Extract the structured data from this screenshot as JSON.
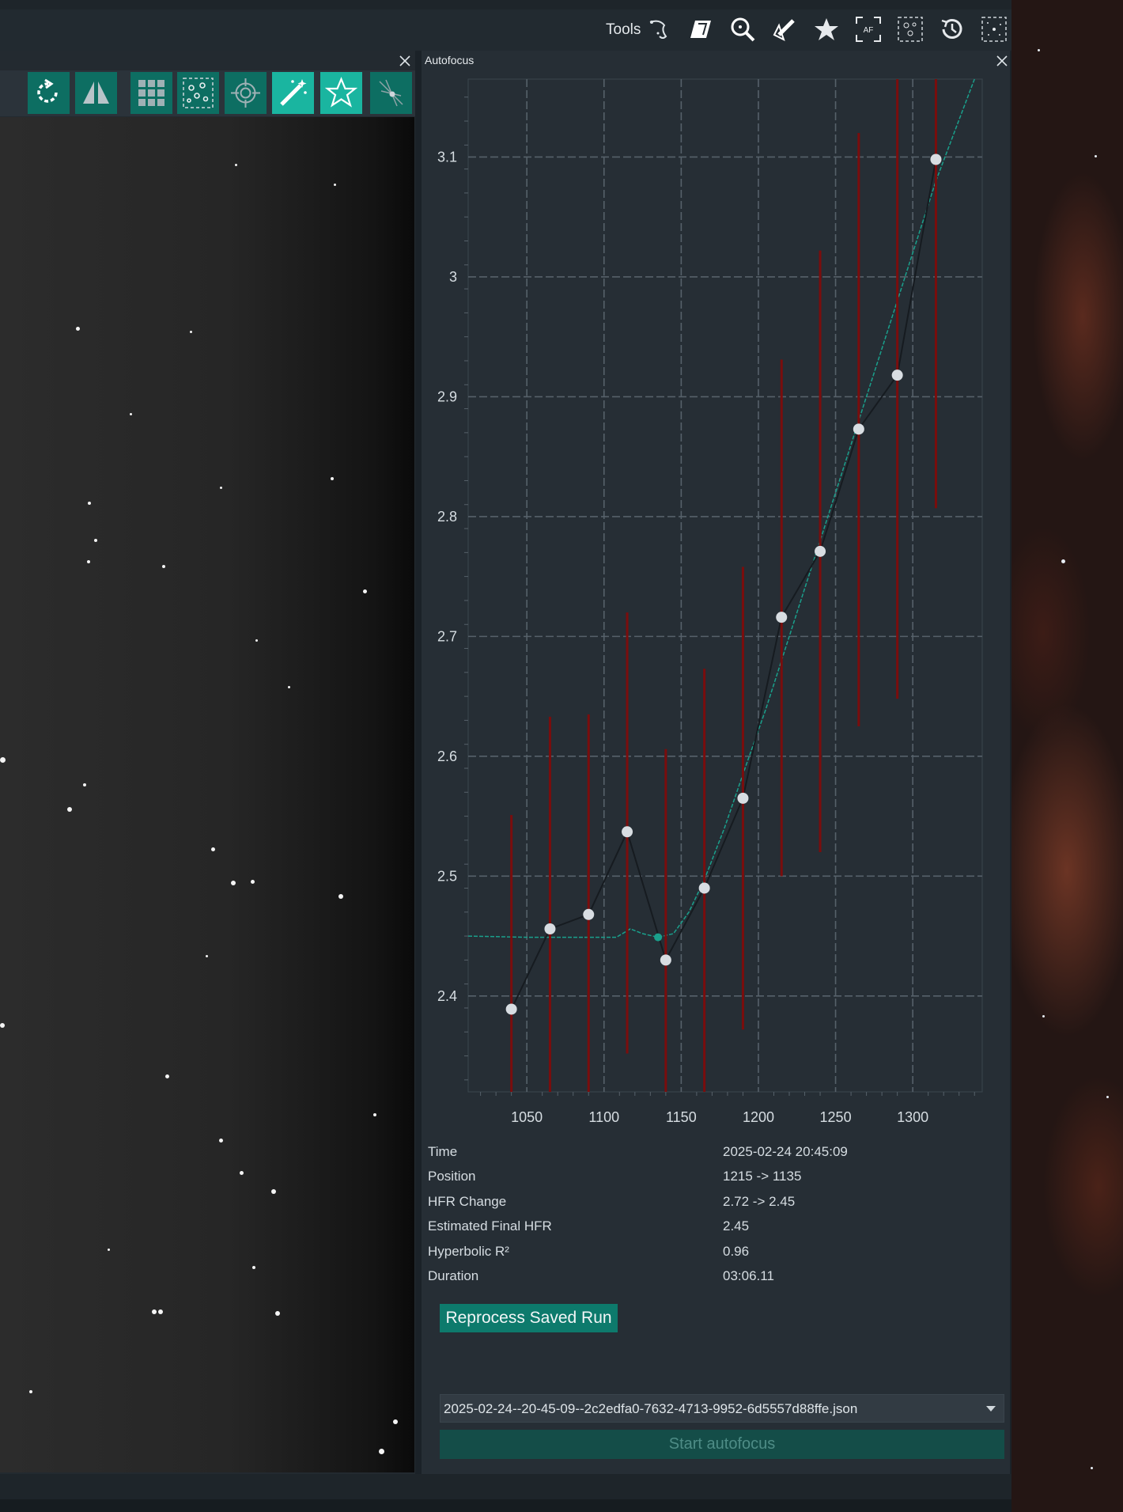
{
  "toolbar": {
    "tools_label": "Tools",
    "icons": [
      "dither-icon",
      "parallelogram-icon",
      "zoom-icon",
      "telescope-icon",
      "star-icon",
      "autofocus-icon",
      "star-detect-icon",
      "history-icon",
      "sky-icon"
    ],
    "af_icon_text": "AF"
  },
  "image_panel": {
    "buttons": [
      "rotate-icon",
      "mirror-icon",
      "grid-icon",
      "stars-icon",
      "crosshair-icon",
      "magic-wand-icon",
      "star-outline-icon",
      "flat-icon"
    ],
    "active_buttons": [
      "magic-wand-icon",
      "star-outline-icon"
    ]
  },
  "autofocus": {
    "title": "Autofocus",
    "stats": [
      {
        "label": "Time",
        "value": "2025-02-24 20:45:09"
      },
      {
        "label": "Position",
        "value": "1215 -> 1135"
      },
      {
        "label": "HFR Change",
        "value": "2.72 -> 2.45"
      },
      {
        "label": "Estimated Final HFR",
        "value": "2.45"
      },
      {
        "label": "Hyperbolic R²",
        "value": "0.96"
      },
      {
        "label": "Duration",
        "value": "03:06.11"
      }
    ],
    "reprocess_label": "Reprocess Saved Run",
    "selected_file": "2025-02-24--20-45-09--2c2edfa0-7632-4713-9952-6d5557d88ffe.json",
    "start_label": "Start autofocus",
    "colors": {
      "accent": "#0d7a6c",
      "error_bar": "#7a0d0d",
      "fit_curve": "#1aa08c"
    }
  },
  "chart_data": {
    "type": "scatter",
    "title": "",
    "xlabel": "",
    "ylabel": "",
    "xlim": [
      1012,
      1345
    ],
    "ylim": [
      2.32,
      3.165
    ],
    "x_ticks": [
      1050,
      1100,
      1150,
      1200,
      1250,
      1300
    ],
    "y_ticks": [
      2.4,
      2.5,
      2.6,
      2.7,
      2.8,
      2.9,
      3.0,
      3.1
    ],
    "y_tick_labels": [
      "2.4",
      "2.5",
      "2.6",
      "2.7",
      "2.8",
      "2.9",
      "3",
      "3.1"
    ],
    "grid": true,
    "points": [
      {
        "x": 1040,
        "y": 2.389,
        "low": 2.32,
        "high": 2.551
      },
      {
        "x": 1065,
        "y": 2.456,
        "low": 2.32,
        "high": 2.633
      },
      {
        "x": 1090,
        "y": 2.468,
        "low": 2.32,
        "high": 2.635
      },
      {
        "x": 1115,
        "y": 2.537,
        "low": 2.352,
        "high": 2.72
      },
      {
        "x": 1140,
        "y": 2.43,
        "low": 2.32,
        "high": 2.606
      },
      {
        "x": 1165,
        "y": 2.49,
        "low": 2.32,
        "high": 2.673
      },
      {
        "x": 1190,
        "y": 2.565,
        "low": 2.372,
        "high": 2.758
      },
      {
        "x": 1215,
        "y": 2.716,
        "low": 2.5,
        "high": 2.931
      },
      {
        "x": 1240,
        "y": 2.771,
        "low": 2.52,
        "high": 3.022
      },
      {
        "x": 1265,
        "y": 2.873,
        "low": 2.625,
        "high": 3.12
      },
      {
        "x": 1290,
        "y": 2.918,
        "low": 2.648,
        "high": 3.165
      },
      {
        "x": 1315,
        "y": 3.098,
        "low": 2.807,
        "high": 3.165
      }
    ],
    "fit_curve": [
      {
        "x": 1012,
        "y": 2.45
      },
      {
        "x": 1050,
        "y": 2.449
      },
      {
        "x": 1080,
        "y": 2.449
      },
      {
        "x": 1108,
        "y": 2.449
      },
      {
        "x": 1117,
        "y": 2.456
      },
      {
        "x": 1125,
        "y": 2.452
      },
      {
        "x": 1135,
        "y": 2.449
      },
      {
        "x": 1145,
        "y": 2.452
      },
      {
        "x": 1155,
        "y": 2.47
      },
      {
        "x": 1165,
        "y": 2.497
      },
      {
        "x": 1178,
        "y": 2.54
      },
      {
        "x": 1190,
        "y": 2.585
      },
      {
        "x": 1205,
        "y": 2.64
      },
      {
        "x": 1220,
        "y": 2.7
      },
      {
        "x": 1235,
        "y": 2.76
      },
      {
        "x": 1250,
        "y": 2.82
      },
      {
        "x": 1265,
        "y": 2.88
      },
      {
        "x": 1280,
        "y": 2.94
      },
      {
        "x": 1295,
        "y": 3.0
      },
      {
        "x": 1315,
        "y": 3.08
      },
      {
        "x": 1340,
        "y": 3.165
      }
    ],
    "min_point": {
      "x": 1135,
      "y": 2.449
    }
  }
}
